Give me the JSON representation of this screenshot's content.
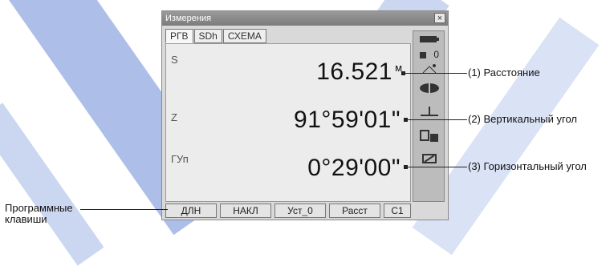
{
  "window": {
    "title": "Измерения",
    "close_glyph": "×"
  },
  "tabs": [
    {
      "label": "РГВ",
      "active": true
    },
    {
      "label": "SDh"
    },
    {
      "label": "СХЕМА"
    }
  ],
  "measurements": [
    {
      "label": "S",
      "value": "16.521",
      "unit": "м"
    },
    {
      "label": "Z",
      "value": "91°59'01\""
    },
    {
      "label": "ГУп",
      "value": "0°29'00\""
    }
  ],
  "iconbar": [
    {
      "icon": "battery-icon"
    },
    {
      "icon": "prism-constant-icon",
      "text": "0"
    },
    {
      "icon": "target-icon"
    },
    {
      "icon": "laser-icon"
    },
    {
      "icon": "tilt-icon"
    },
    {
      "icon": "memory-icon"
    },
    {
      "icon": "input-mode-icon"
    }
  ],
  "softkeys": [
    {
      "label": "ДЛН"
    },
    {
      "label": "НАКЛ"
    },
    {
      "label": "Уст_0"
    },
    {
      "label": "Расст"
    },
    {
      "label": "C1"
    }
  ],
  "callouts": [
    {
      "text": "(1) Расстояние"
    },
    {
      "text": "(2) Вертикальный угол"
    },
    {
      "text": "(3) Горизонтальный угол"
    }
  ],
  "softkeys_caption": "Программные клавиши"
}
